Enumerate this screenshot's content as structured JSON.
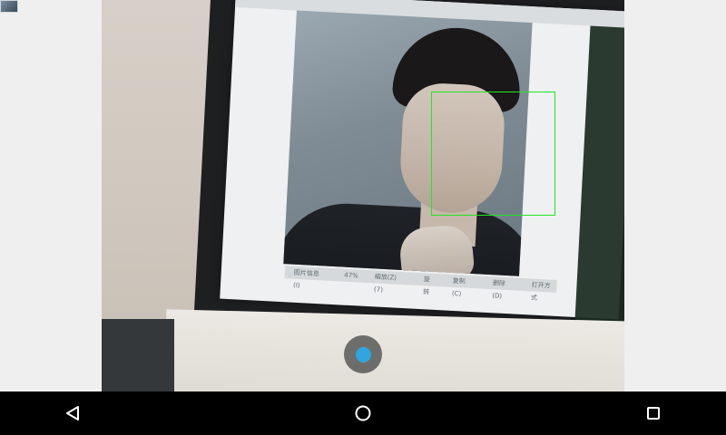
{
  "screen": {
    "app_icon": "camera-app-icon"
  },
  "preview": {
    "description_elements": {
      "face_box_color": "#23e623"
    },
    "status_strip": [
      "图片信息 (I)",
      "47%",
      "缩放(Z) (7)",
      "旋转",
      "复制 (C)",
      "删除(D)",
      "打开方式"
    ]
  },
  "controls": {
    "shutter_color": "#2fa6e0",
    "shutter_icon": "shutter-dot-icon"
  },
  "navbar": {
    "back_icon": "back-triangle-icon",
    "home_icon": "home-circle-icon",
    "recents_icon": "recents-square-icon"
  }
}
